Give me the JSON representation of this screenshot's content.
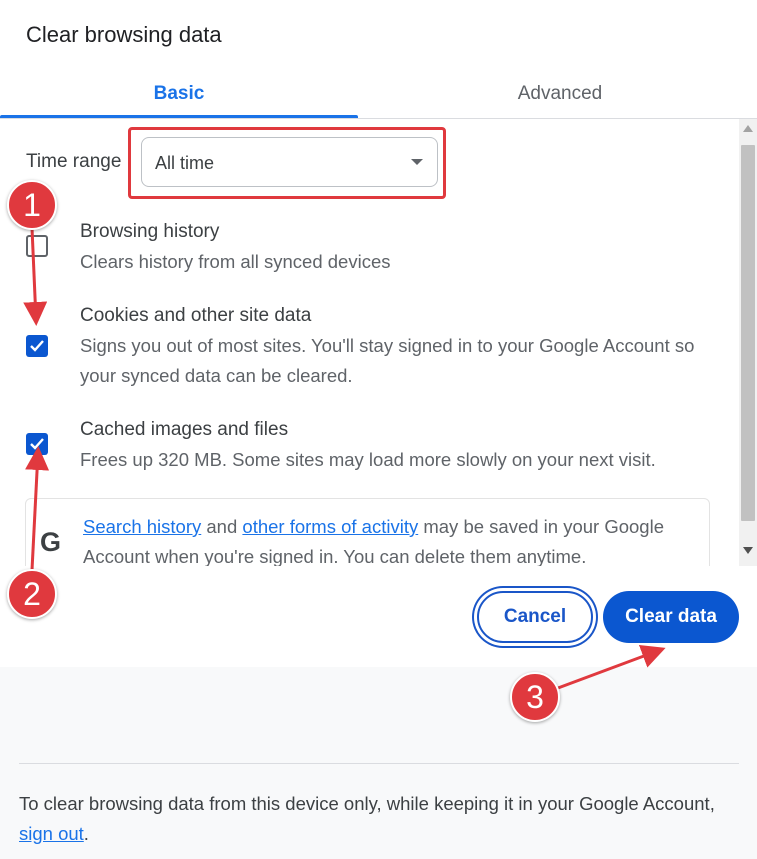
{
  "dialog": {
    "title": "Clear browsing data"
  },
  "tabs": [
    {
      "label": "Basic",
      "active": true
    },
    {
      "label": "Advanced",
      "active": false
    }
  ],
  "time_range": {
    "label": "Time range",
    "value": "All time"
  },
  "options": [
    {
      "title": "Browsing history",
      "description": "Clears history from all synced devices",
      "checked": false
    },
    {
      "title": "Cookies and other site data",
      "description": "Signs you out of most sites. You'll stay signed in to your Google Account so your synced data can be cleared.",
      "checked": true
    },
    {
      "title": "Cached images and files",
      "description": "Frees up 320 MB. Some sites may load more slowly on your next visit.",
      "checked": true
    }
  ],
  "info": {
    "icon": "google-g-icon",
    "link1": "Search history",
    "text1": " and ",
    "link2": "other forms of activity",
    "text2": " may be saved in your Google Account when you're signed in. You can delete them anytime."
  },
  "buttons": {
    "cancel": "Cancel",
    "clear": "Clear data"
  },
  "footer": {
    "text": "To clear browsing data from this device only, while keeping it in your Google Account, ",
    "link": "sign out",
    "end": "."
  },
  "annotations": {
    "badge1": "1",
    "badge2": "2",
    "badge3": "3"
  },
  "colors": {
    "accent": "#1a73e8",
    "primary_button": "#0b57d0",
    "annotation_red": "#e0393e"
  }
}
